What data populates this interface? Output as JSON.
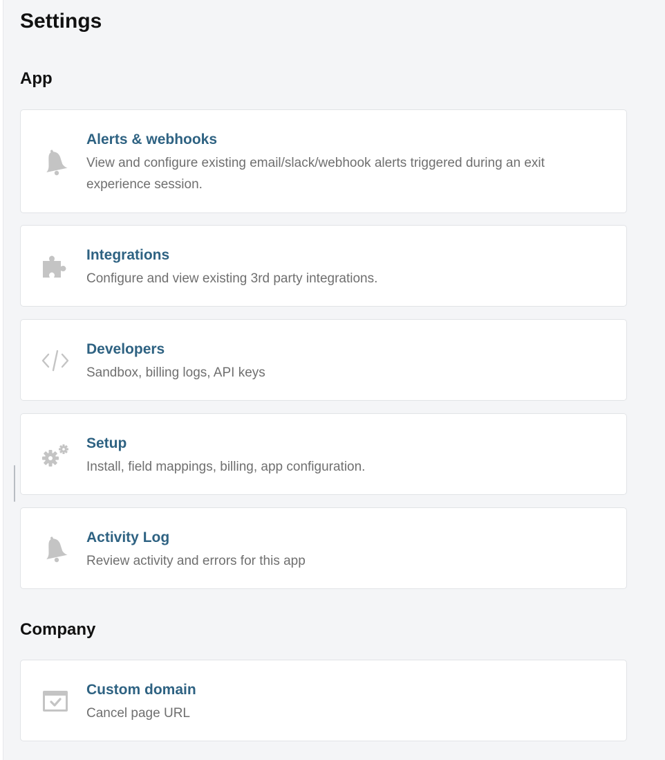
{
  "page": {
    "title": "Settings"
  },
  "sections": {
    "app": {
      "title": "App",
      "items": [
        {
          "title": "Alerts & webhooks",
          "description": "View and configure existing email/slack/webhook alerts triggered during an exit experience session.",
          "icon": "bell-icon"
        },
        {
          "title": "Integrations",
          "description": "Configure and view existing 3rd party integrations.",
          "icon": "puzzle-icon"
        },
        {
          "title": "Developers",
          "description": "Sandbox, billing logs, API keys",
          "icon": "code-icon"
        },
        {
          "title": "Setup",
          "description": "Install, field mappings, billing, app configuration.",
          "icon": "gears-icon"
        },
        {
          "title": "Activity Log",
          "description": "Review activity and errors for this app",
          "icon": "bell-icon"
        }
      ]
    },
    "company": {
      "title": "Company",
      "items": [
        {
          "title": "Custom domain",
          "description": "Cancel page URL",
          "icon": "browser-check-icon"
        }
      ]
    }
  },
  "colors": {
    "background": "#f4f5f7",
    "card": "#ffffff",
    "card_border": "#e1e3e6",
    "link_title": "#2e6282",
    "description": "#6f6f6f",
    "icon": "#c4c4c4"
  }
}
